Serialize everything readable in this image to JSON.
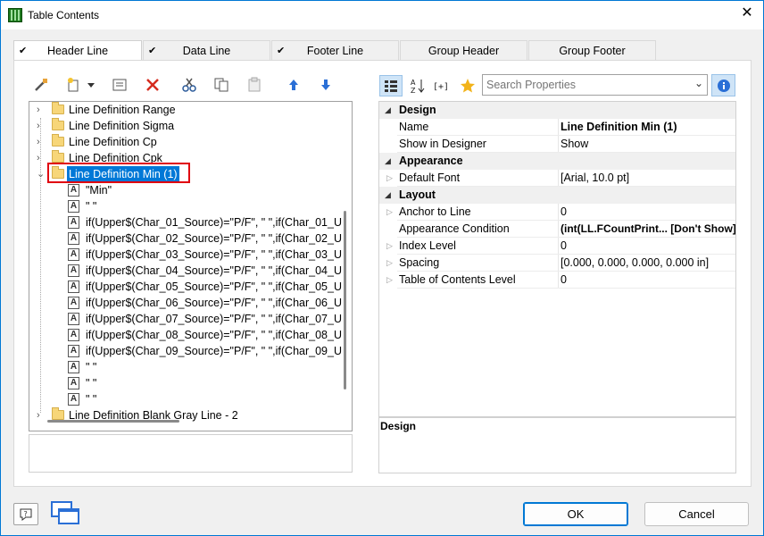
{
  "window": {
    "title": "Table Contents"
  },
  "tabs": [
    {
      "label": "Header Line",
      "checked": true,
      "active": true
    },
    {
      "label": "Data Line",
      "checked": true,
      "active": false
    },
    {
      "label": "Footer Line",
      "checked": true,
      "active": false
    },
    {
      "label": "Group Header",
      "checked": false,
      "active": false
    },
    {
      "label": "Group Footer",
      "checked": false,
      "active": false
    }
  ],
  "tree": {
    "items": [
      {
        "label": "Line Definition Range",
        "kind": "folder"
      },
      {
        "label": "Line Definition Sigma",
        "kind": "folder"
      },
      {
        "label": "Line Definition Cp",
        "kind": "folder"
      },
      {
        "label": "Line Definition Cpk",
        "kind": "folder"
      },
      {
        "label": "Line Definition Min (1)",
        "kind": "folder",
        "selected": true,
        "expanded": true
      },
      {
        "label": "\"Min\"",
        "kind": "field"
      },
      {
        "label": "\" \"",
        "kind": "field"
      },
      {
        "label": "if(Upper$(Char_01_Source)=\"P/F\", \" \",if(Char_01_U",
        "kind": "field"
      },
      {
        "label": "if(Upper$(Char_02_Source)=\"P/F\", \" \",if(Char_02_U",
        "kind": "field"
      },
      {
        "label": "if(Upper$(Char_03_Source)=\"P/F\", \" \",if(Char_03_U",
        "kind": "field"
      },
      {
        "label": "if(Upper$(Char_04_Source)=\"P/F\", \" \",if(Char_04_U",
        "kind": "field"
      },
      {
        "label": "if(Upper$(Char_05_Source)=\"P/F\", \" \",if(Char_05_U",
        "kind": "field"
      },
      {
        "label": "if(Upper$(Char_06_Source)=\"P/F\", \" \",if(Char_06_U",
        "kind": "field"
      },
      {
        "label": "if(Upper$(Char_07_Source)=\"P/F\", \" \",if(Char_07_U",
        "kind": "field"
      },
      {
        "label": "if(Upper$(Char_08_Source)=\"P/F\", \" \",if(Char_08_U",
        "kind": "field"
      },
      {
        "label": "if(Upper$(Char_09_Source)=\"P/F\", \" \",if(Char_09_U",
        "kind": "field"
      },
      {
        "label": "\" \"",
        "kind": "field"
      },
      {
        "label": "\" \"",
        "kind": "field"
      },
      {
        "label": "\" \"",
        "kind": "field"
      },
      {
        "label": "Line Definition Blank Gray Line - 2",
        "kind": "folder"
      }
    ]
  },
  "search": {
    "placeholder": "Search Properties"
  },
  "properties": [
    {
      "type": "category",
      "name": "Design"
    },
    {
      "type": "prop",
      "name": "Name",
      "value": "Line Definition Min (1)",
      "bold": true
    },
    {
      "type": "prop",
      "name": "Show in Designer",
      "value": "Show"
    },
    {
      "type": "category",
      "name": "Appearance"
    },
    {
      "type": "prop",
      "name": "Default Font",
      "value": "[Arial, 10.0 pt]",
      "expandable": true
    },
    {
      "type": "category",
      "name": "Layout"
    },
    {
      "type": "prop",
      "name": "Anchor to Line",
      "value": "0",
      "expandable": true
    },
    {
      "type": "prop",
      "name": "Appearance Condition",
      "value": "(int(LL.FCountPrint...  [Don't Show]",
      "bold": true
    },
    {
      "type": "prop",
      "name": "Index Level",
      "value": "0",
      "expandable": true
    },
    {
      "type": "prop",
      "name": "Spacing",
      "value": "[0.000, 0.000, 0.000, 0.000 in]",
      "expandable": true
    },
    {
      "type": "prop",
      "name": "Table of Contents Level",
      "value": "0",
      "expandable": true
    }
  ],
  "description": {
    "title": "Design"
  },
  "buttons": {
    "ok": "OK",
    "cancel": "Cancel"
  },
  "colors": {
    "accent": "#0078d7",
    "highlight_box": "#e0000f",
    "folder": "#f7d679"
  }
}
